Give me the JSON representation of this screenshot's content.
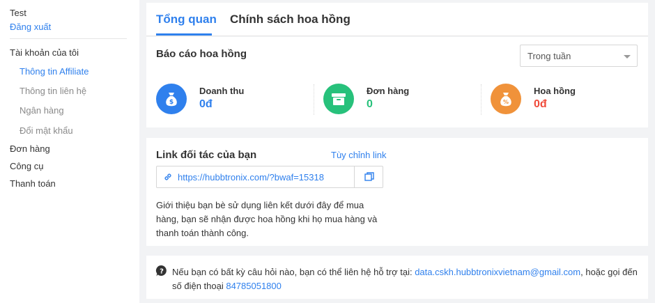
{
  "sidebar": {
    "user_name": "Test",
    "logout": "Đăng xuất",
    "account_section": "Tài khoản của tôi",
    "sub_items": [
      "Thông tin Affiliate",
      "Thông tin liên hệ",
      "Ngân hàng",
      "Đổi mật khẩu"
    ],
    "main_items": [
      "Đơn hàng",
      "Công cụ",
      "Thanh toán"
    ]
  },
  "tabs": {
    "overview": "Tổng quan",
    "commission_policy": "Chính sách hoa hồng"
  },
  "report": {
    "title": "Báo cáo hoa hồng",
    "period": "Trong tuần",
    "stats": [
      {
        "label": "Doanh thu",
        "value": "0đ",
        "color": "#2f80ed",
        "icon": "money-bag-icon"
      },
      {
        "label": "Đơn hàng",
        "value": "0",
        "color": "#27c17b",
        "icon": "box-icon"
      },
      {
        "label": "Hoa hồng",
        "value": "0đ",
        "color": "#f0923a",
        "icon": "percent-bag-icon"
      }
    ],
    "value_colors": [
      "#2f80ed",
      "#27c17b",
      "#f04b3b"
    ]
  },
  "link": {
    "title": "Link đối tác của bạn",
    "customize": "Tùy chỉnh link",
    "url": "https://hubbtronix.com/?bwaf=15318",
    "description": "Giới thiệu bạn bè sử dụng liên kết dưới đây để mua hàng, bạn sẽ nhận được hoa hồng khi họ mua hàng và thanh toán thành công."
  },
  "support": {
    "text_before": "Nếu bạn có bất kỳ câu hỏi nào, bạn có thể liên hệ hỗ trợ tại: ",
    "email": "data.cskh.hubbtronixvietnam@gmail.com",
    "text_middle": ", hoặc gọi đến số điện thoại ",
    "phone": "84785051800"
  }
}
